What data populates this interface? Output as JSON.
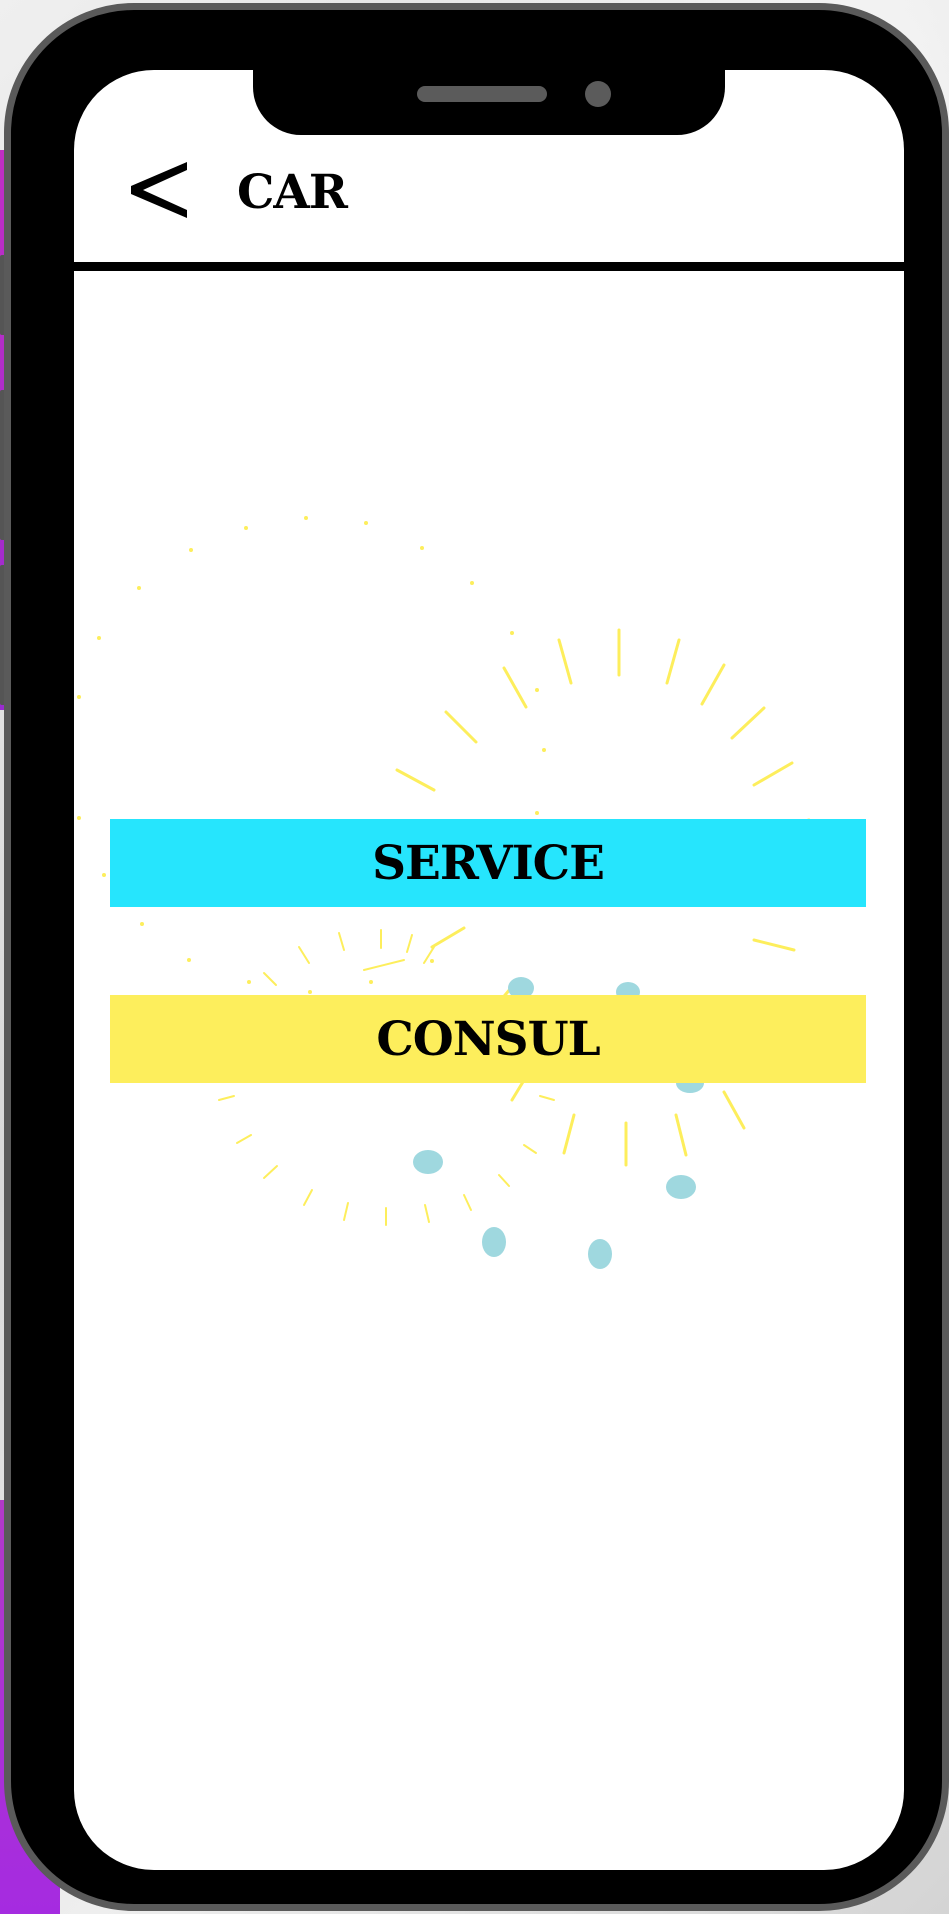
{
  "header": {
    "back_icon": "chevron-left-icon",
    "title": "CAR"
  },
  "menu": {
    "service_label": "SERVICE",
    "consul_label": "CONSUL"
  },
  "colors": {
    "service_button": "#26e5fd",
    "consul_button": "#fdee5c",
    "decoration_rays": "#fdee5c",
    "decoration_dots": "#9fd8df"
  }
}
